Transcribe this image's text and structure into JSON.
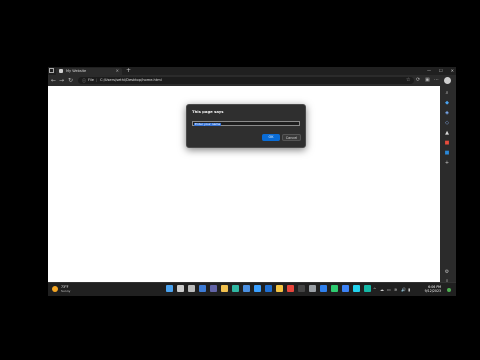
{
  "browser": {
    "tab_title": "My Website",
    "tab_close": "×",
    "new_tab": "+",
    "window_controls": [
      "—",
      "☐",
      "✕"
    ],
    "address": {
      "info_icon": "ⓘ",
      "scheme": "File",
      "separator": "|",
      "url": "C:/Users/sethi/Desktop/home.html"
    },
    "nav_icons": [
      "←",
      "→",
      "↻"
    ],
    "toolbar_icons": [
      "☆",
      "⟳",
      "▣",
      "⋯"
    ]
  },
  "dialog": {
    "heading": "This page says",
    "input_value": "Enter your name",
    "ok_label": "OK",
    "cancel_label": "Cancel"
  },
  "sidebar_icons": [
    {
      "name": "search-icon",
      "glyph": "⌕",
      "color": "#cccccc"
    },
    {
      "name": "copilot-icon",
      "glyph": "◆",
      "color": "#4aa3f0"
    },
    {
      "name": "shopping-icon",
      "glyph": "◈",
      "color": "#7fb4ff"
    },
    {
      "name": "tools-icon",
      "glyph": "◇",
      "color": "#8ab4f8"
    },
    {
      "name": "games-icon",
      "glyph": "▲",
      "color": "#d9d9d9"
    },
    {
      "name": "office-icon",
      "glyph": "■",
      "color": "#e74c3c"
    },
    {
      "name": "outlook-icon",
      "glyph": "■",
      "color": "#2b88d8"
    },
    {
      "name": "add-icon",
      "glyph": "+",
      "color": "#cccccc"
    }
  ],
  "taskbar": {
    "weather_temp": "73°F",
    "weather_cond": "Sunny",
    "time": "6:06 PM",
    "date": "9/12/2023",
    "apps": [
      {
        "name": "start-icon",
        "color": "#4aa3f0"
      },
      {
        "name": "search-icon",
        "color": "#cccccc"
      },
      {
        "name": "task-view-icon",
        "color": "#bbbbbb"
      },
      {
        "name": "widgets-icon",
        "color": "#3d7bd6"
      },
      {
        "name": "chat-icon",
        "color": "#6264a7"
      },
      {
        "name": "file-explorer-icon",
        "color": "#f2c14e"
      },
      {
        "name": "edge-icon",
        "color": "#2fb7a3"
      },
      {
        "name": "store-icon",
        "color": "#4a90e2"
      },
      {
        "name": "photos-icon",
        "color": "#3aa0ff"
      },
      {
        "name": "mail-icon",
        "color": "#1f6fd1"
      },
      {
        "name": "folder-icon",
        "color": "#f5c542"
      },
      {
        "name": "chrome-icon",
        "color": "#e8453c"
      },
      {
        "name": "terminal-icon",
        "color": "#444444"
      },
      {
        "name": "settings-icon",
        "color": "#9aa0a6"
      },
      {
        "name": "code-icon",
        "color": "#2f80ed"
      },
      {
        "name": "app-green-icon",
        "color": "#2ecc71"
      },
      {
        "name": "app-blue-icon",
        "color": "#3b82f6"
      },
      {
        "name": "app-cyan-icon",
        "color": "#22d3ee"
      },
      {
        "name": "app-teal-icon",
        "color": "#14b8a6"
      }
    ],
    "tray_icons": [
      "^",
      "☁",
      "▭",
      "≋",
      "🔊",
      "▮"
    ]
  }
}
